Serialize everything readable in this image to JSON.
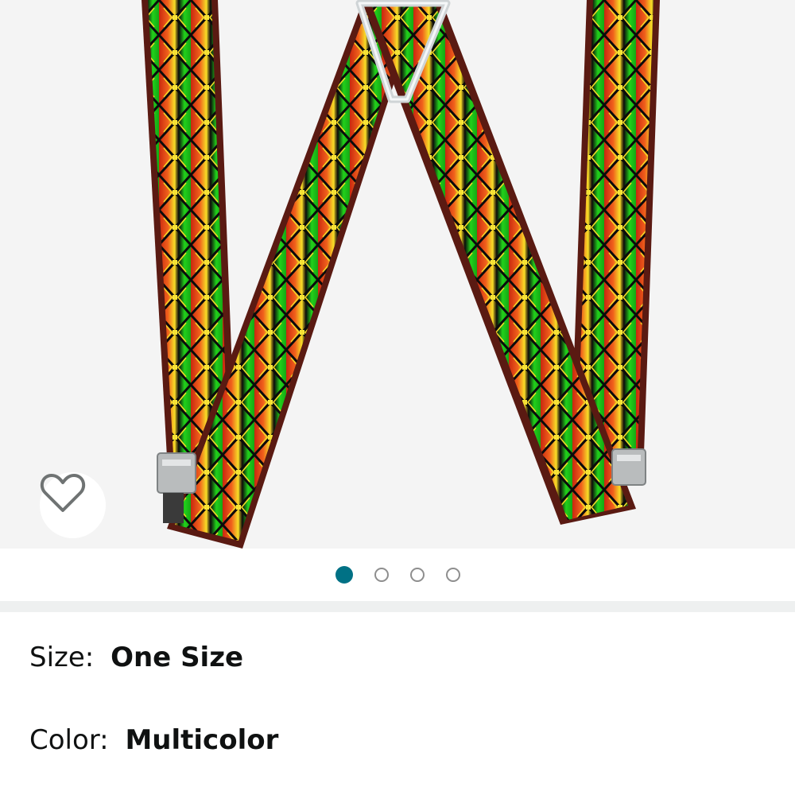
{
  "product_image": {
    "description_icon": "suspenders-product-photo",
    "colors": {
      "red": "#e8461a",
      "green": "#1fd01a",
      "yellow": "#f2e22a",
      "black": "#0d0d0d",
      "border": "#5a1a12"
    }
  },
  "wishlist": {
    "icon": "heart-outline-icon"
  },
  "carousel": {
    "count": 4,
    "active_index": 0,
    "active_color": "#007185"
  },
  "variants": {
    "size_label": "Size:",
    "size_value": "One Size",
    "color_label": "Color:",
    "color_value": "Multicolor"
  }
}
